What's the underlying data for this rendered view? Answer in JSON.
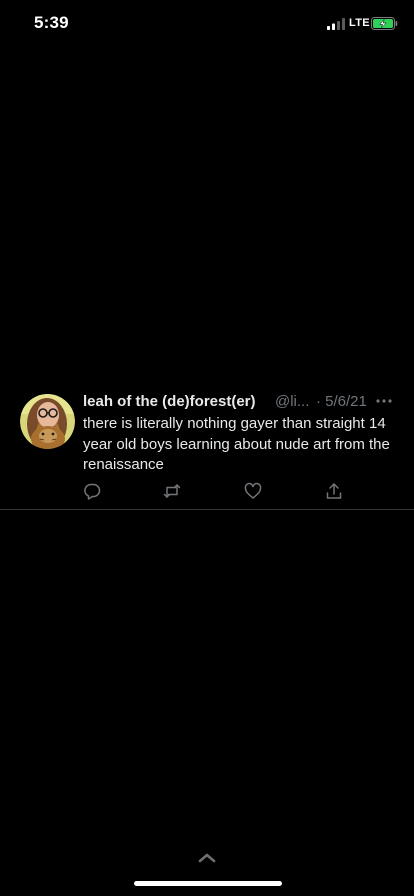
{
  "status_bar": {
    "time": "5:39",
    "network": "LTE",
    "icons": [
      "signal-icon",
      "battery-charging-icon"
    ],
    "battery_color": "#30d158"
  },
  "tweet": {
    "author_name": "leah of the (de)forest(er)",
    "author_handle": "@li...",
    "date": "· 5/6/21",
    "text": "there is literally nothing gayer than straight 14 year old boys learning about nude art from the renaissance",
    "avatar_icon": "user-avatar",
    "actions": [
      "reply-icon",
      "retweet-icon",
      "like-icon",
      "share-icon"
    ],
    "more_icon": "more-icon"
  },
  "colors": {
    "background": "#000000",
    "text_primary": "#e7e9ea",
    "text_secondary": "#71767b",
    "divider": "#2f3336"
  },
  "bottom": {
    "icons": [
      "chevron-up-icon",
      "home-indicator"
    ]
  }
}
